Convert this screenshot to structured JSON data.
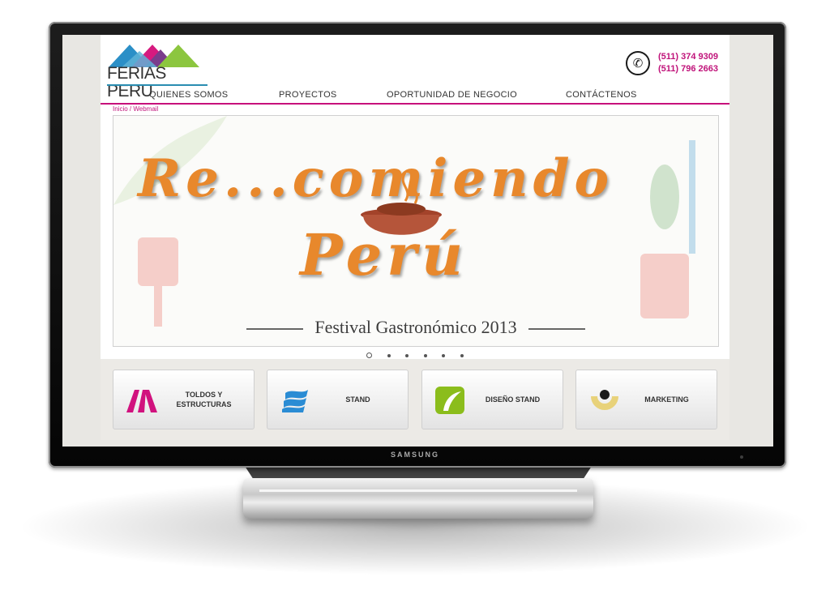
{
  "monitor": {
    "brand": "SAMSUNG"
  },
  "site": {
    "logo": {
      "text": "FERIAS PERU"
    },
    "phones": [
      "(511) 374 9309",
      "(511) 796 2663"
    ],
    "nav": [
      "QUIENES SOMOS",
      "PROYECTOS",
      "OPORTUNIDAD DE NEGOCIO",
      "CONTÁCTENOS"
    ],
    "breadcrumb": "Inicio / Webmail",
    "banner": {
      "line1": "Re...comiendo",
      "line2": "Perú",
      "subtitle": "Festival Gastronómico 2013"
    },
    "slider_dots": {
      "count": 6,
      "active_index": 0
    },
    "services": [
      {
        "label": "TOLDOS Y ESTRUCTURAS",
        "icon": "tent-structure-icon",
        "color": "#d1127e"
      },
      {
        "label": "STAND",
        "icon": "stand-waves-icon",
        "color": "#2a8cd4"
      },
      {
        "label": "DISEÑO STAND",
        "icon": "design-stand-icon",
        "color": "#8bbd1c"
      },
      {
        "label": "MARKETING",
        "icon": "marketing-target-icon",
        "color": "#e8d27a"
      }
    ]
  },
  "colors": {
    "accent": "#c0137a",
    "nav_line": "#c7107b",
    "banner_text": "#e8882c"
  }
}
